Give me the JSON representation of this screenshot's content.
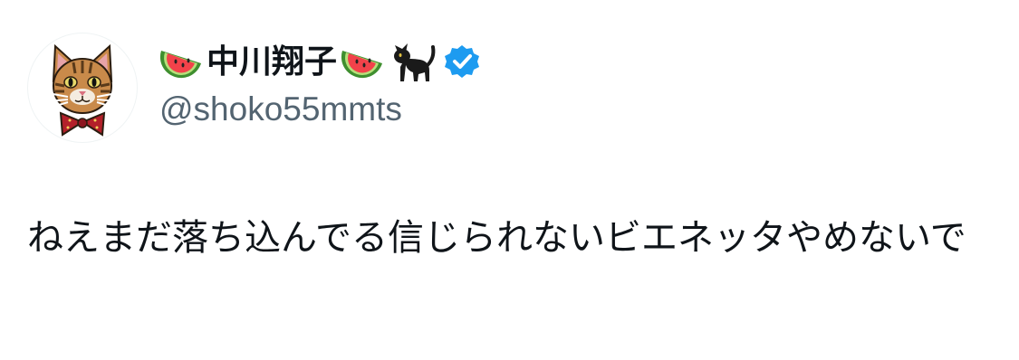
{
  "author": {
    "display_name": "中川翔子",
    "handle": "@shoko55mmts",
    "verified": true,
    "name_prefix_icon": "watermelon-emoji",
    "name_suffix_icons": [
      "watermelon-emoji",
      "black-cat-emoji"
    ],
    "verified_color": "#1d9bf0"
  },
  "tweet": {
    "text": "ねえまだ落ち込んでる信じられないビエネッタやめないで"
  },
  "colors": {
    "text_primary": "#0f1419",
    "text_secondary": "#536471"
  }
}
